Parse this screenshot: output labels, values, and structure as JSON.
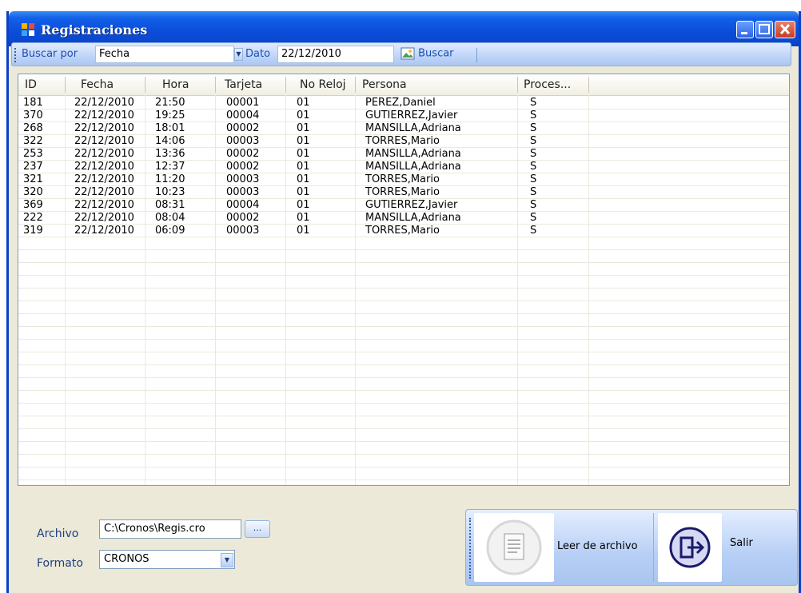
{
  "window": {
    "title": "Registraciones"
  },
  "toolbar": {
    "buscar_por_label": "Buscar por",
    "buscar_por_value": "Fecha",
    "dato_label": "Dato",
    "dato_value": "22/12/2010",
    "buscar_label": "Buscar"
  },
  "grid": {
    "headers": [
      "ID",
      "Fecha",
      "Hora",
      "Tarjeta",
      "No Reloj",
      "Persona",
      "Proces..."
    ],
    "rows": [
      [
        "181",
        "22/12/2010",
        "21:50",
        "00001",
        "01",
        "PEREZ,Daniel",
        "S"
      ],
      [
        "370",
        "22/12/2010",
        "19:25",
        "00004",
        "01",
        "GUTIERREZ,Javier",
        "S"
      ],
      [
        "268",
        "22/12/2010",
        "18:01",
        "00002",
        "01",
        "MANSILLA,Adriana",
        "S"
      ],
      [
        "322",
        "22/12/2010",
        "14:06",
        "00003",
        "01",
        "TORRES,Mario",
        "S"
      ],
      [
        "253",
        "22/12/2010",
        "13:36",
        "00002",
        "01",
        "MANSILLA,Adriana",
        "S"
      ],
      [
        "237",
        "22/12/2010",
        "12:37",
        "00002",
        "01",
        "MANSILLA,Adriana",
        "S"
      ],
      [
        "321",
        "22/12/2010",
        "11:20",
        "00003",
        "01",
        "TORRES,Mario",
        "S"
      ],
      [
        "320",
        "22/12/2010",
        "10:23",
        "00003",
        "01",
        "TORRES,Mario",
        "S"
      ],
      [
        "369",
        "22/12/2010",
        "08:31",
        "00004",
        "01",
        "GUTIERREZ,Javier",
        "S"
      ],
      [
        "222",
        "22/12/2010",
        "08:04",
        "00002",
        "01",
        "MANSILLA,Adriana",
        "S"
      ],
      [
        "319",
        "22/12/2010",
        "06:09",
        "00003",
        "01",
        "TORRES,Mario",
        "S"
      ]
    ]
  },
  "form": {
    "archivo_label": "Archivo",
    "archivo_value": "C:\\Cronos\\Regis.cro",
    "browse_label": "...",
    "formato_label": "Formato",
    "formato_value": "CRONOS"
  },
  "actions": {
    "leer_label": "Leer de archivo",
    "salir_label": "Salir"
  },
  "colors": {
    "titlebar": "#0a4cd8",
    "toolbar": "#bed4f8",
    "accent_text": "#1f4fb0"
  }
}
